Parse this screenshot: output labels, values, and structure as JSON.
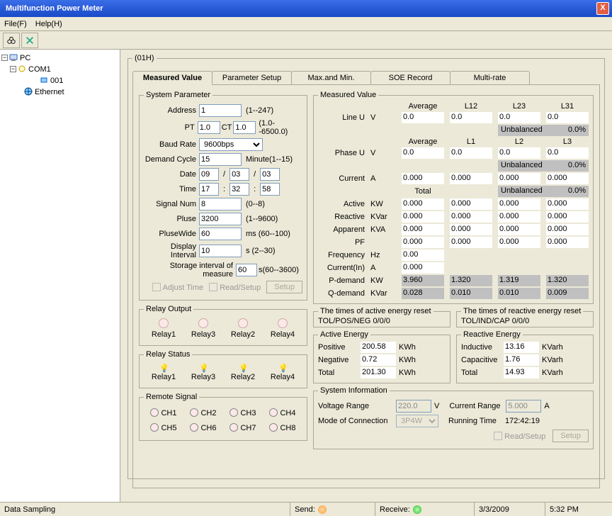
{
  "window": {
    "title": "Multifunction Power Meter",
    "close": "X"
  },
  "menu": {
    "file": "File(F)",
    "help": "Help(H)"
  },
  "toolbar": {
    "icon1": "binoculars-icon",
    "icon2": "refresh-icon"
  },
  "tree": {
    "root": "PC",
    "com": "COM1",
    "dev": "001",
    "eth": "Ethernet"
  },
  "group_id": "(01H)",
  "tabs": [
    "Measured Value",
    "Parameter Setup",
    "Max.and Min.",
    "SOE Record",
    "Multi-rate"
  ],
  "sys": {
    "legend": "System Parameter",
    "address_lbl": "Address",
    "address_val": "1",
    "address_rng": "(1--247)",
    "pt_lbl": "PT",
    "pt_val": "1.0",
    "ct_lbl": "CT",
    "ct_val": "1.0",
    "ptct_rng": "(1.0--6500.0)",
    "baud_lbl": "Baud Rate",
    "baud_val": "9600bps",
    "demand_lbl": "Demand Cycle",
    "demand_val": "15",
    "demand_rng": "Minute(1--15)",
    "date_lbl": "Date",
    "date_y": "09",
    "date_m": "03",
    "date_d": "03",
    "time_lbl": "Time",
    "time_h": "17",
    "time_m": "32",
    "time_s": "58",
    "signal_lbl": "Signal Num",
    "signal_val": "8",
    "signal_rng": "(0--8)",
    "pluse_lbl": "Pluse",
    "pluse_val": "3200",
    "pluse_rng": "(1--9600)",
    "plusew_lbl": "PluseWide",
    "plusew_val": "60",
    "plusew_rng": "ms (60--100)",
    "disp_lbl": "Display Interval",
    "disp_val": "10",
    "disp_rng": "s (2--30)",
    "store_lbl": "Storage interval of measure",
    "store_val": "60",
    "store_rng": "s(60--3600)",
    "adjust": "Adjust Time",
    "readsetup": "Read/Setup",
    "setup": "Setup"
  },
  "relay_out": {
    "legend": "Relay Output",
    "r1": "Relay1",
    "r2": "Relay3",
    "r3": "Relay2",
    "r4": "Relay4"
  },
  "relay_stat": {
    "legend": "Relay Status",
    "r1": "Relay1",
    "r2": "Relay3",
    "r3": "Relay2",
    "r4": "Relay4"
  },
  "remote": {
    "legend": "Remote Signal",
    "ch": [
      "CH1",
      "CH2",
      "CH3",
      "CH4",
      "CH5",
      "CH6",
      "CH7",
      "CH8"
    ]
  },
  "mv": {
    "legend": "Measured Value",
    "avg": "Average",
    "l12": "L12",
    "l23": "L23",
    "l31": "L31",
    "lineu": "Line U",
    "lineu_u": "V",
    "l1": "L1",
    "l2": "L2",
    "l3": "L3",
    "phaseu": "Phase U",
    "phaseu_u": "V",
    "current": "Current",
    "current_u": "A",
    "total": "Total",
    "unbal": "Unbalanced",
    "unbal_v": "0.0%",
    "active": "Active",
    "active_u": "KW",
    "reactive": "Reactive",
    "reactive_u": "KVar",
    "apparent": "Apparent",
    "apparent_u": "KVA",
    "pf": "PF",
    "freq": "Frequency",
    "freq_u": "Hz",
    "curin": "Current(In)",
    "curin_u": "A",
    "pdem": "P-demand",
    "pdem_u": "KW",
    "qdem": "Q-demand",
    "qdem_u": "KVar",
    "vals": {
      "lineu": [
        "0.0",
        "0.0",
        "0.0",
        "0.0"
      ],
      "phaseu": [
        "0.0",
        "0.0",
        "0.0",
        "0.0"
      ],
      "current": [
        "0.000",
        "0.000",
        "0.000",
        "0.000"
      ],
      "active": [
        "0.000",
        "0.000",
        "0.000",
        "0.000"
      ],
      "reactive": [
        "0.000",
        "0.000",
        "0.000",
        "0.000"
      ],
      "apparent": [
        "0.000",
        "0.000",
        "0.000",
        "0.000"
      ],
      "pf": [
        "0.000",
        "0.000",
        "0.000",
        "0.000"
      ],
      "freq": "0.00",
      "curin": "0.000",
      "pdem": [
        "3.960",
        "1.320",
        "1.319",
        "1.320"
      ],
      "qdem": [
        "0.028",
        "0.010",
        "0.010",
        "0.009"
      ]
    }
  },
  "reset": {
    "active_leg": "The times of active energy reset",
    "active_lbl": "TOL/POS/NEG",
    "active_val": "0/0/0",
    "react_leg": "The times of reactive energy reset",
    "react_lbl": "TOL/IND/CAP",
    "react_val": "0/0/0"
  },
  "ae": {
    "legend": "Active Energy",
    "pos": "Positive",
    "pos_v": "200.58",
    "neg": "Negative",
    "neg_v": "0.72",
    "tot": "Total",
    "tot_v": "201.30",
    "u": "KWh"
  },
  "re": {
    "legend": "Reactive Energy",
    "ind": "Inductive",
    "ind_v": "13.16",
    "cap": "Capacitive",
    "cap_v": "1.76",
    "tot": "Total",
    "tot_v": "14.93",
    "u": "KVarh"
  },
  "si": {
    "legend": "System Information",
    "vr": "Voltage Range",
    "vr_v": "220.0",
    "vr_u": "V",
    "cr": "Current Range",
    "cr_v": "5.000",
    "cr_u": "A",
    "mc": "Mode of Connection",
    "mc_v": "3P4W",
    "rt": "Running Time",
    "rt_v": "172:42:19",
    "rs": "Read/Setup",
    "setup": "Setup"
  },
  "status": {
    "sampling": "Data Sampling",
    "send": "Send:",
    "recv": "Receive:",
    "date": "3/3/2009",
    "time": "5:32 PM"
  }
}
